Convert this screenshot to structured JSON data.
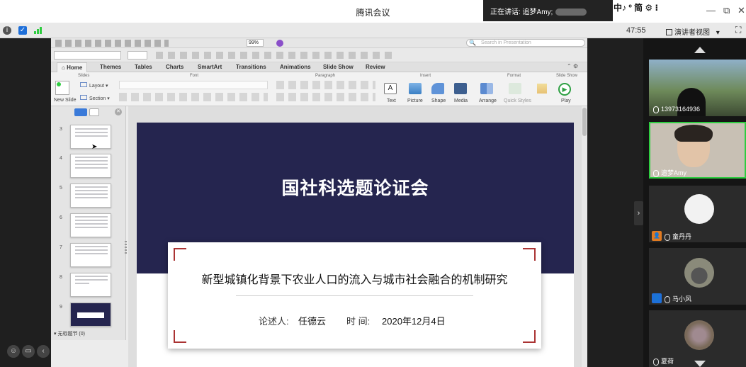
{
  "window": {
    "title": "腾讯会议",
    "speaking_label": "正在讲话: 追梦Amy;",
    "ime": "中♪ º 简 ⚙ ⁝",
    "controls": {
      "minimize": "—",
      "restore": "⧉",
      "close": "✕"
    }
  },
  "meeting_bar": {
    "timer": "47:55",
    "view_button": "演讲者视图",
    "view_caret": "▾",
    "fullscreen": "⛶"
  },
  "ppt": {
    "zoom": "99%",
    "search_placeholder": "Search in Presentation",
    "tabs": [
      "Home",
      "Themes",
      "Tables",
      "Charts",
      "SmartArt",
      "Transitions",
      "Animations",
      "Slide Show",
      "Review"
    ],
    "groups": {
      "slides": "Slides",
      "font": "Font",
      "paragraph": "Paragraph",
      "insert": "Insert",
      "format": "Format",
      "slide_show": "Slide Show"
    },
    "buttons": {
      "new_slide": "New Slide",
      "layout": "Layout",
      "section": "Section",
      "text": "Text",
      "picture": "Picture",
      "shape": "Shape",
      "media": "Media",
      "arrange": "Arrange",
      "quick_styles": "Quick Styles",
      "play": "Play"
    },
    "thumbnails": [
      "3",
      "4",
      "5",
      "6",
      "7",
      "8",
      "9"
    ],
    "section_label": "无标题节 (0)"
  },
  "slide": {
    "title": "国社科选题论证会",
    "subtitle": "新型城镇化背景下农业人口的流入与城市社会融合的机制研究",
    "presenter_label": "论述人:",
    "presenter_name": "任德云",
    "date_label": "时  间:",
    "date_value": "2020年12月4日"
  },
  "participants": [
    {
      "name": "13973164936",
      "muted": false
    },
    {
      "name": "追梦Amy",
      "muted": false
    },
    {
      "name": "童丹丹",
      "muted": true
    },
    {
      "name": "马小风",
      "muted": true
    },
    {
      "name": "夏荷",
      "muted": true
    }
  ],
  "colors": {
    "slide_navy": "#25254f",
    "accent_red": "#aa3333",
    "active_green": "#2ecc40"
  }
}
